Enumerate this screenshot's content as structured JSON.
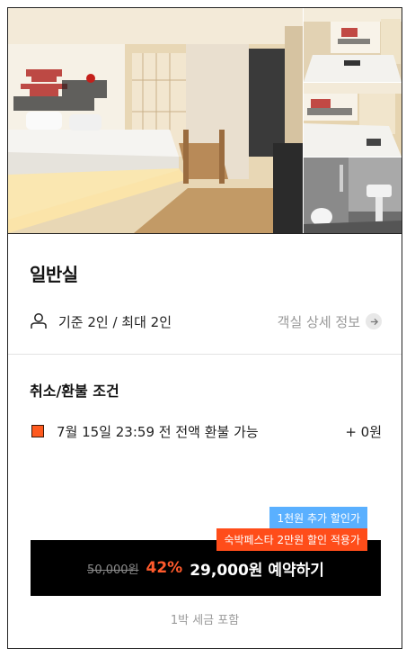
{
  "room": {
    "title": "일반실",
    "capacity": "기준 2인 / 최대 2인",
    "detail_link": "객실 상세 정보"
  },
  "policy": {
    "title": "취소/환불 조건",
    "items": [
      {
        "text": "7월 15일 23:59 전 전액 환불 가능",
        "amount": "+ 0원",
        "color": "#ff5a1f"
      }
    ]
  },
  "promo": {
    "badge_blue": "1천원 추가 할인가",
    "badge_orange": "숙박페스타 2만원 할인 적용가"
  },
  "booking": {
    "original_price": "50,000원",
    "discount": "42%",
    "label": "29,000원 예약하기"
  },
  "tax_note": "1박 세금 포함",
  "colors": {
    "accent_orange": "#ff4d1a",
    "accent_blue": "#5ab0ff",
    "button_bg": "#000000"
  }
}
